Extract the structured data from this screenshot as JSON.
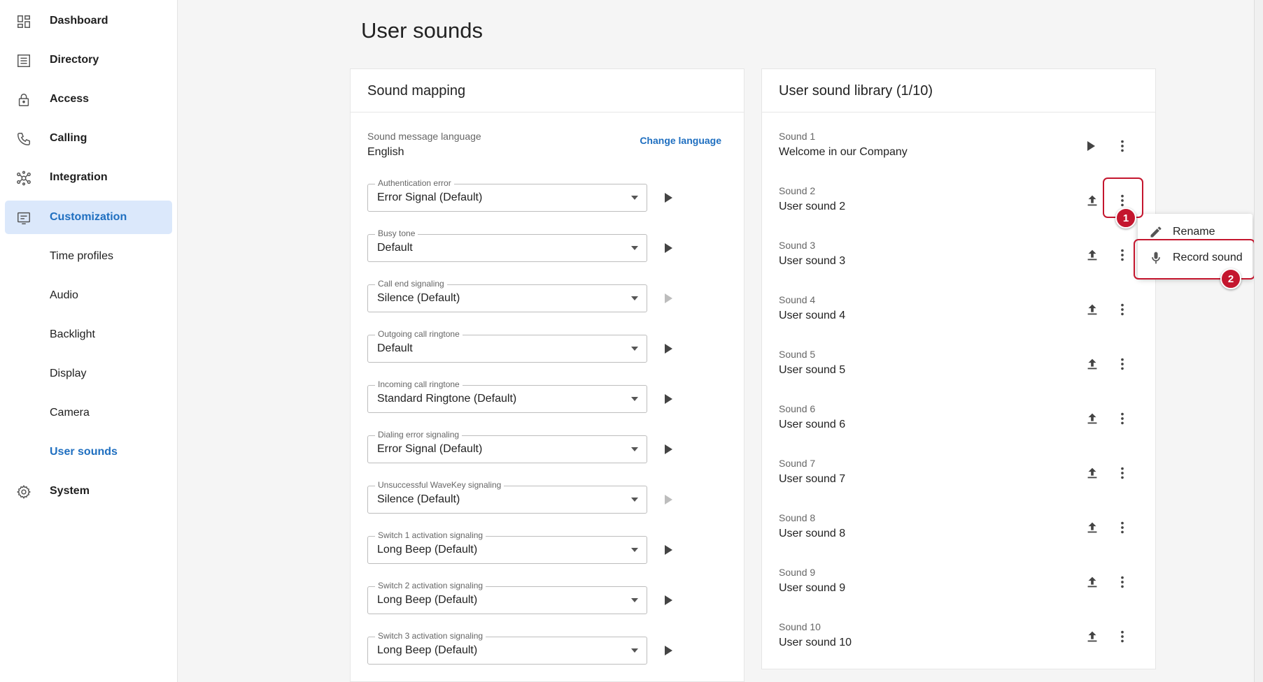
{
  "sidebar": {
    "items": [
      {
        "label": "Dashboard",
        "icon": "dashboard-icon"
      },
      {
        "label": "Directory",
        "icon": "directory-icon"
      },
      {
        "label": "Access",
        "icon": "lock-icon"
      },
      {
        "label": "Calling",
        "icon": "phone-icon"
      },
      {
        "label": "Integration",
        "icon": "integration-icon"
      },
      {
        "label": "Customization",
        "icon": "customization-icon",
        "active": true
      },
      {
        "label": "Time profiles"
      },
      {
        "label": "Audio"
      },
      {
        "label": "Backlight"
      },
      {
        "label": "Display"
      },
      {
        "label": "Camera"
      },
      {
        "label": "User sounds",
        "current": true
      },
      {
        "label": "System",
        "icon": "gear-icon"
      }
    ]
  },
  "page": {
    "title": "User sounds"
  },
  "mapping": {
    "title": "Sound mapping",
    "language_label": "Sound message language",
    "language_value": "English",
    "change_language": "Change language",
    "fields": [
      {
        "label": "Authentication error",
        "value": "Error Signal (Default)",
        "play_enabled": true
      },
      {
        "label": "Busy tone",
        "value": "Default",
        "play_enabled": true
      },
      {
        "label": "Call end signaling",
        "value": "Silence (Default)",
        "play_enabled": false
      },
      {
        "label": "Outgoing call ringtone",
        "value": "Default",
        "play_enabled": true
      },
      {
        "label": "Incoming call ringtone",
        "value": "Standard Ringtone (Default)",
        "play_enabled": true
      },
      {
        "label": "Dialing error signaling",
        "value": "Error Signal (Default)",
        "play_enabled": true
      },
      {
        "label": "Unsuccessful WaveKey signaling",
        "value": "Silence (Default)",
        "play_enabled": false
      },
      {
        "label": "Switch 1 activation signaling",
        "value": "Long Beep (Default)",
        "play_enabled": true
      },
      {
        "label": "Switch 2 activation signaling",
        "value": "Long Beep (Default)",
        "play_enabled": true
      },
      {
        "label": "Switch 3 activation signaling",
        "value": "Long Beep (Default)",
        "play_enabled": true
      }
    ]
  },
  "library": {
    "title": "User sound library (1/10)",
    "sounds": [
      {
        "label": "Sound 1",
        "value": "Welcome in our Company",
        "action": "play"
      },
      {
        "label": "Sound 2",
        "value": "User sound 2",
        "action": "upload"
      },
      {
        "label": "Sound 3",
        "value": "User sound 3",
        "action": "upload"
      },
      {
        "label": "Sound 4",
        "value": "User sound 4",
        "action": "upload"
      },
      {
        "label": "Sound 5",
        "value": "User sound 5",
        "action": "upload"
      },
      {
        "label": "Sound 6",
        "value": "User sound 6",
        "action": "upload"
      },
      {
        "label": "Sound 7",
        "value": "User sound 7",
        "action": "upload"
      },
      {
        "label": "Sound 8",
        "value": "User sound 8",
        "action": "upload"
      },
      {
        "label": "Sound 9",
        "value": "User sound 9",
        "action": "upload"
      },
      {
        "label": "Sound 10",
        "value": "User sound 10",
        "action": "upload"
      }
    ]
  },
  "menu": {
    "rename": "Rename",
    "record": "Record sound"
  },
  "annotations": {
    "step1": "1",
    "step2": "2",
    "color": "#c4162e"
  },
  "colors": {
    "accent": "#1f6fc0",
    "active_bg": "#dbe8fb"
  }
}
